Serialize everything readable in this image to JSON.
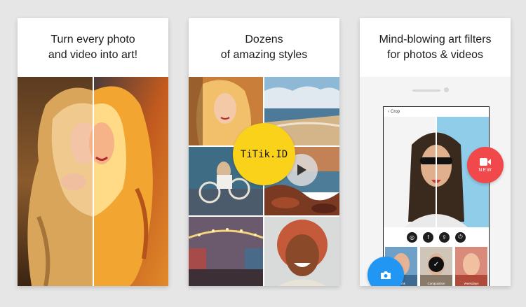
{
  "cards": [
    {
      "heading_line1": "Turn every photo",
      "heading_line2": "and video into art!"
    },
    {
      "heading_line1": "Dozens",
      "heading_line2": "of amazing styles"
    },
    {
      "heading_line1": "Mind-blowing art filters",
      "heading_line2": "for photos & videos"
    }
  ],
  "watermark": {
    "text": "TiTik.ID"
  },
  "phone": {
    "back_label": "Crop",
    "new_button_label": "NEW",
    "filters": [
      {
        "label": "Tsunk"
      },
      {
        "label": "Composition"
      },
      {
        "label": "Weekdays"
      }
    ]
  },
  "colors": {
    "background": "#e6e6e6",
    "new_button": "#f1484c",
    "camera_button": "#2196f3",
    "watermark_badge": "#fbd21a"
  },
  "icons": [
    "play-icon",
    "video-camera-icon",
    "camera-icon",
    "instagram-icon",
    "facebook-icon",
    "share-icon",
    "power-icon",
    "chevron-left-icon",
    "checkmark-icon"
  ]
}
